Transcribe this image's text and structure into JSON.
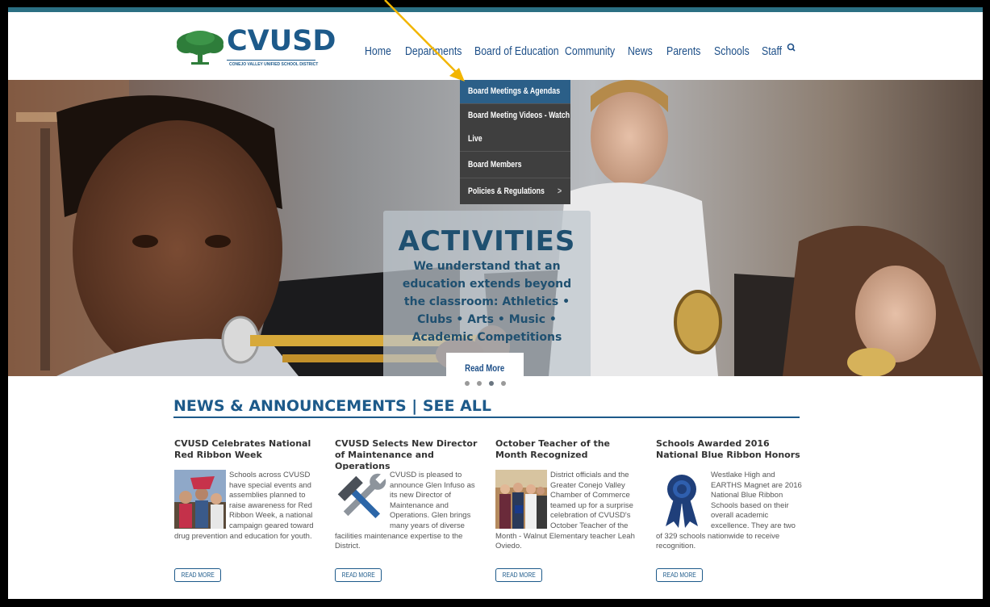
{
  "colors": {
    "brand": "#1d5a8a",
    "dropdown_bg": "#3f3f3f",
    "dropdown_active": "#2b5f88",
    "annotation_arrow": "#f2b500"
  },
  "logo": {
    "text": "CVUSD",
    "subtitle": "CONEJO VALLEY UNIFIED SCHOOL DISTRICT",
    "icon": "oak-tree-icon"
  },
  "nav": {
    "items": [
      {
        "label": "Home"
      },
      {
        "label": "Departments"
      },
      {
        "label": "Board of Education"
      },
      {
        "label": "Community"
      },
      {
        "label": "News"
      },
      {
        "label": "Parents"
      },
      {
        "label": "Schools"
      },
      {
        "label": "Staff"
      }
    ],
    "active_index": 2,
    "search_icon": "search-icon"
  },
  "dropdown": {
    "items": [
      {
        "label": "Board Meetings & Agendas",
        "active": true
      },
      {
        "label": "Board Meeting Videos - Watch Live",
        "line1": "Board Meeting Videos - Watch",
        "line2": "Live"
      },
      {
        "label": "Board Members"
      },
      {
        "label": "Policies & Regulations",
        "arrow": ">"
      }
    ]
  },
  "hero": {
    "title": "ACTIVITIES",
    "text": "We understand that an education extends beyond the classroom: Athletics • Clubs • Arts • Music • Academic Competitions",
    "button": "Read More",
    "slides": 4,
    "active_slide": 2
  },
  "news": {
    "heading": "NEWS & ANNOUNCEMENTS | SEE ALL",
    "articles": [
      {
        "title": "CVUSD Celebrates National Red Ribbon Week",
        "text": "Schools across CVUSD have special events and assemblies planned to raise awareness for Red Ribbon Week, a national campaign geared toward drug prevention and education for youth.",
        "image": "students-photo",
        "button": "READ MORE"
      },
      {
        "title": "CVUSD Selects New Director of Maintenance and Operations",
        "text": "CVUSD is pleased to announce Glen Infuso as its new Director of Maintenance and Operations. Glen brings many years of diverse facilities maintenance expertise to the District.",
        "image": "wrench-hammer-icon",
        "button": "READ MORE"
      },
      {
        "title": "October Teacher of the Month Recognized",
        "text": "District officials and the Greater Conejo Valley Chamber of Commerce teamed up for a surprise celebration of CVUSD's October Teacher of the Month - Walnut Elementary teacher Leah Oviedo.",
        "image": "group-photo",
        "button": "READ MORE"
      },
      {
        "title": "Schools Awarded 2016 National Blue Ribbon Honors",
        "text": "Westlake High and EARTHS Magnet are 2016 National Blue Ribbon Schools based on their overall academic excellence. They are two of 329 schools nationwide to receive recognition.",
        "image": "blue-ribbon-icon",
        "button": "READ MORE"
      }
    ]
  }
}
